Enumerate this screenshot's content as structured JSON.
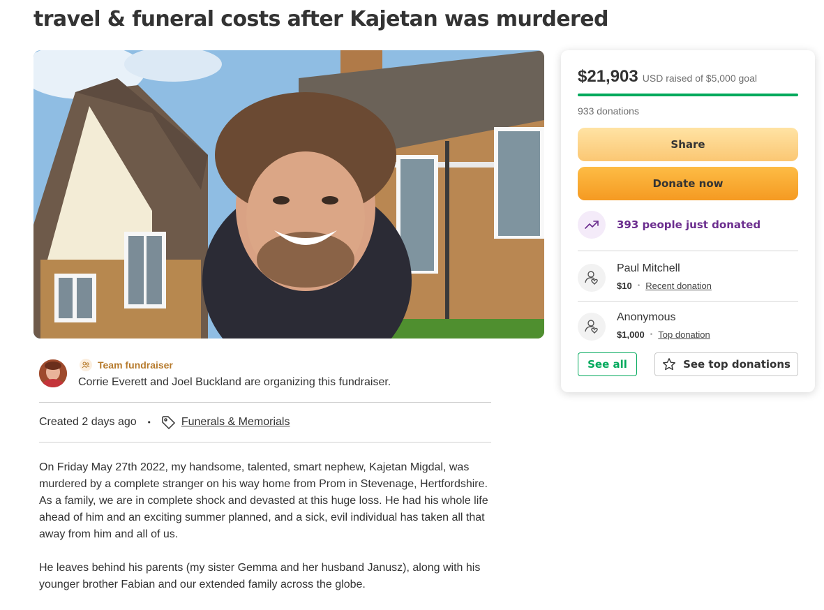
{
  "page_title": "travel & funeral costs after Kajetan was murdered",
  "organizer": {
    "team_label": "Team fundraiser",
    "text": "Corrie Everett and Joel Buckland are organizing this fundraiser."
  },
  "meta": {
    "created": "Created 2 days ago",
    "separator": "•",
    "category": "Funerals & Memorials",
    "category_icon": "tag-icon"
  },
  "story": {
    "paragraphs": [
      "On Friday May 27th 2022, my handsome, talented, smart nephew, Kajetan Migdal, was murdered by a complete stranger on his way home from Prom in Stevenage, Hertfordshire. As a family, we are in complete shock and devasted at this huge loss. He had his whole life ahead of him and an exciting summer planned, and a sick, evil individual has taken all that away from him and all of us.",
      "He leaves behind his parents (my sister Gemma and her husband Janusz), along with his younger brother Fabian and our extended family across the globe."
    ]
  },
  "donation_card": {
    "amount_raised": "$21,903",
    "goal_text": "USD raised of $5,000 goal",
    "progress_fraction": 1.0,
    "donations_count": "933 donations",
    "share_label": "Share",
    "donate_label": "Donate now",
    "trend_text": "393 people just donated",
    "trend_icon": "trending-up-icon",
    "donors": [
      {
        "name": "Paul Mitchell",
        "amount": "$10",
        "separator": "•",
        "type": "Recent donation",
        "icon": "donor-heart-icon"
      },
      {
        "name": "Anonymous",
        "amount": "$1,000",
        "separator": "•",
        "type": "Top donation",
        "icon": "donor-heart-icon"
      }
    ],
    "see_all_label": "See all",
    "see_top_label": "See top donations"
  },
  "colors": {
    "brand_green": "#02a95c",
    "donate_orange": "#f59a22",
    "share_yellow": "#fbc773",
    "trend_purple": "#6b2d8e",
    "team_gold": "#b67a2c"
  }
}
